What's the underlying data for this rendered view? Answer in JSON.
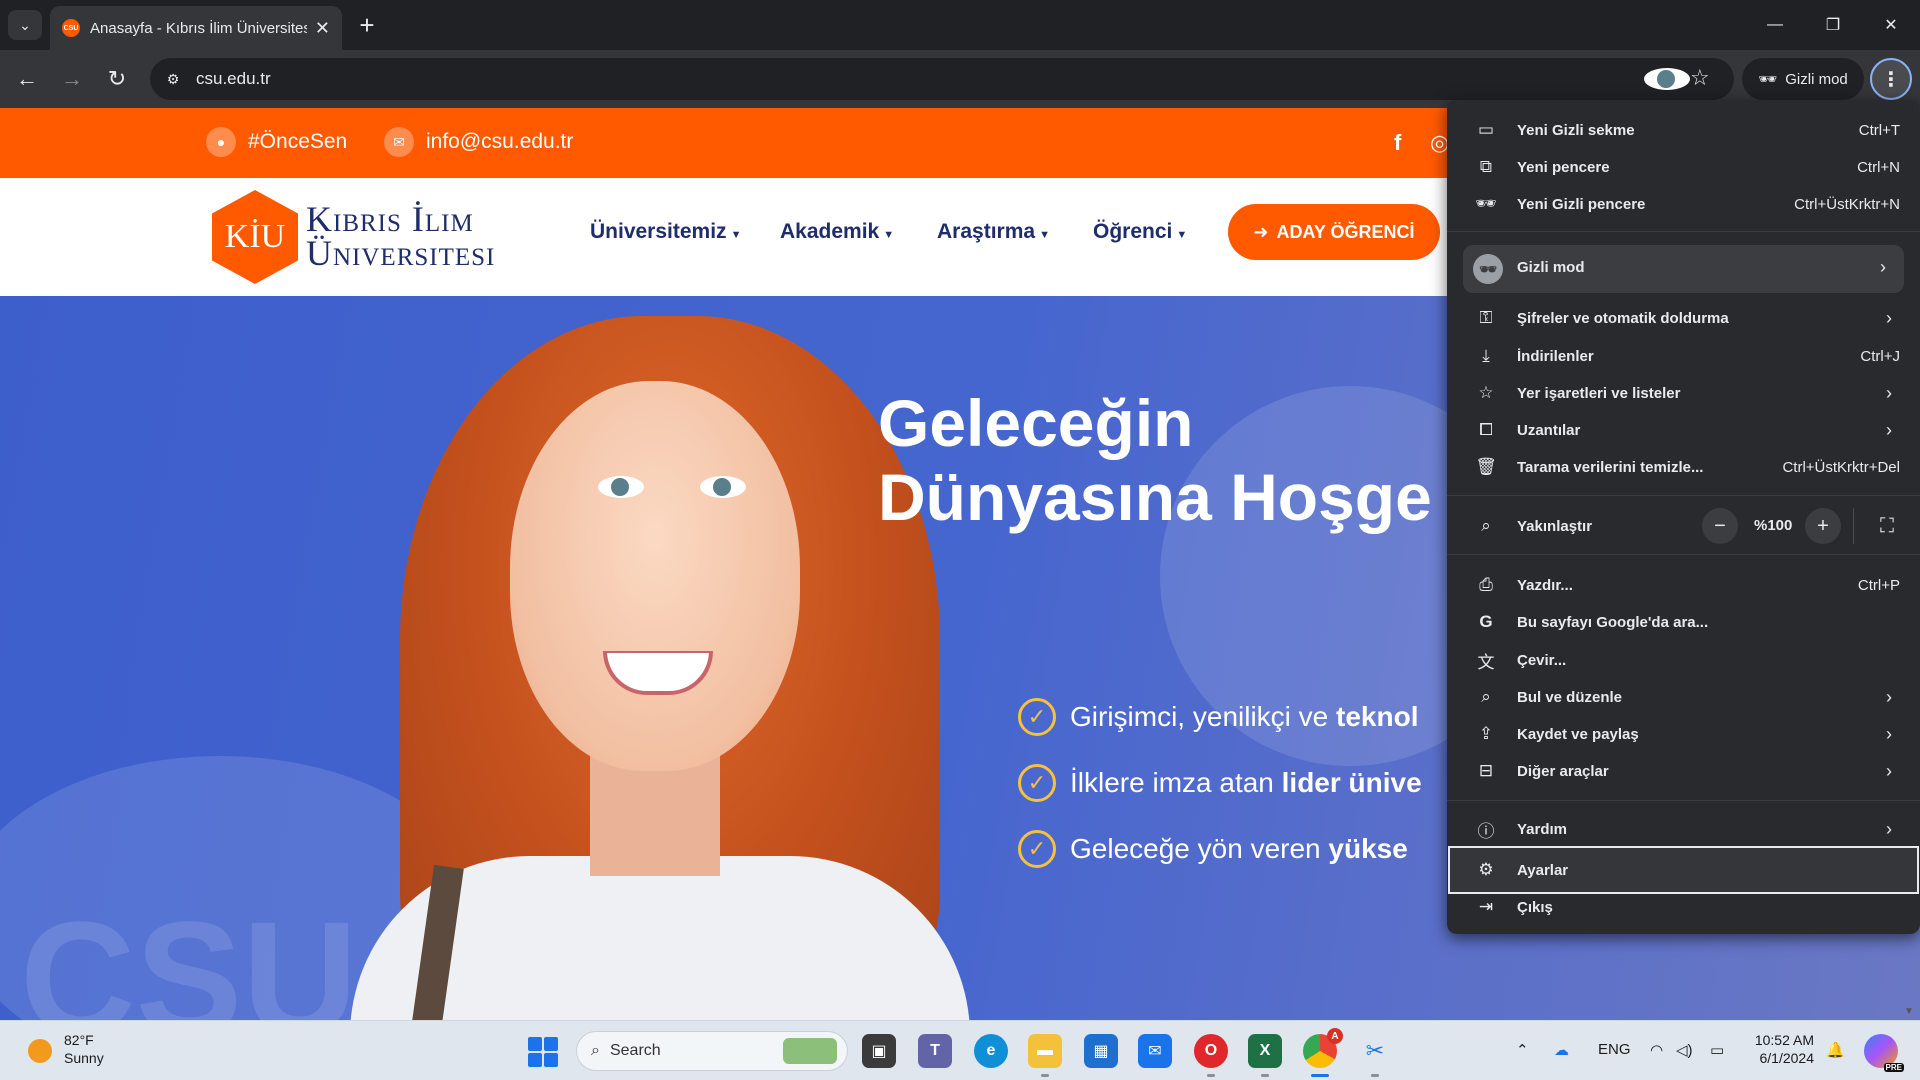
{
  "browser": {
    "tab_title": "Anasayfa - Kıbrıs İlim Üniversitesi",
    "favicon_text": "CSU",
    "url": "csu.edu.tr",
    "incognito_label": "Gizli mod"
  },
  "site": {
    "topbar": {
      "hashtag": "#ÖnceSen",
      "email": "info@csu.edu.tr"
    },
    "logo": {
      "mark": "KİU",
      "line1": "Kıbrıs İlim",
      "line2": "Üniversitesi"
    },
    "nav": [
      "Üniversitemiz",
      "Akademik",
      "Araştırma",
      "Öğrenci"
    ],
    "cta": "ADAY ÖĞRENCİ",
    "hero": {
      "title_line1": "Geleceğin",
      "title_line2": "Dünyasına Hoşge",
      "watermark": "CSU",
      "bullets": [
        {
          "text": "Girişimci, yenilikçi ve ",
          "bold": "teknol"
        },
        {
          "text": "İlklere imza atan ",
          "bold": "lider ünive"
        },
        {
          "text": "Geleceğe yön veren ",
          "bold": "yükse"
        }
      ]
    }
  },
  "menu": {
    "items": [
      {
        "icon": "new-tab-icon",
        "label": "Yeni Gizli sekme",
        "shortcut": "Ctrl+T"
      },
      {
        "icon": "new-window-icon",
        "label": "Yeni pencere",
        "shortcut": "Ctrl+N"
      },
      {
        "icon": "incognito-icon",
        "label": "Yeni Gizli pencere",
        "shortcut": "Ctrl+ÜstKrktr+N"
      },
      {
        "icon": "incognito-avatar-icon",
        "label": "Gizli mod"
      },
      {
        "icon": "key-icon",
        "label": "Şifreler ve otomatik doldurma"
      },
      {
        "icon": "download-icon",
        "label": "İndirilenler",
        "shortcut": "Ctrl+J"
      },
      {
        "icon": "star-icon",
        "label": "Yer işaretleri ve listeler"
      },
      {
        "icon": "extension-icon",
        "label": "Uzantılar"
      },
      {
        "icon": "trash-icon",
        "label": "Tarama verilerini temizle...",
        "shortcut": "Ctrl+ÜstKrktr+Del"
      },
      {
        "icon": "zoom-icon",
        "label": "Yakınlaştır",
        "value": "%100"
      },
      {
        "icon": "print-icon",
        "label": "Yazdır...",
        "shortcut": "Ctrl+P"
      },
      {
        "icon": "google-icon",
        "label": "Bu sayfayı Google'da ara..."
      },
      {
        "icon": "translate-icon",
        "label": "Çevir..."
      },
      {
        "icon": "find-icon",
        "label": "Bul ve düzenle"
      },
      {
        "icon": "save-share-icon",
        "label": "Kaydet ve paylaş"
      },
      {
        "icon": "toolbox-icon",
        "label": "Diğer araçlar"
      },
      {
        "icon": "help-icon",
        "label": "Yardım"
      },
      {
        "icon": "gear-icon",
        "label": "Ayarlar"
      },
      {
        "icon": "exit-icon",
        "label": "Çıkış"
      }
    ]
  },
  "taskbar": {
    "temp": "82°F",
    "condition": "Sunny",
    "search_placeholder": "Search",
    "lang": "ENG",
    "time": "10:52 AM",
    "date": "6/1/2024",
    "chrome_badge": "A",
    "copilot_badge": "PRE"
  },
  "colors": {
    "brand_orange": "#ff5a00",
    "brand_navy": "#1f2d6b",
    "hero_blue": "#3d5fcc",
    "menu_bg": "#292a2d"
  }
}
